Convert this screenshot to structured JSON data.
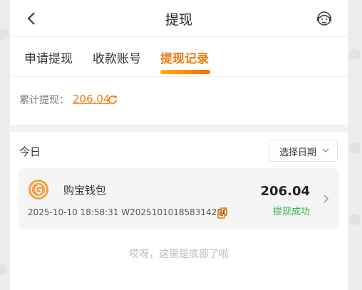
{
  "header": {
    "title": "提现",
    "back_icon": "chevron-left-icon",
    "service_icon": "customer-service-icon"
  },
  "tabs": [
    {
      "label": "申请提现",
      "active": false
    },
    {
      "label": "收款账号",
      "active": false
    },
    {
      "label": "提现记录",
      "active": true
    }
  ],
  "total": {
    "label": "累计提现：",
    "amount": "206.04",
    "refresh_icon": "refresh-icon"
  },
  "filter": {
    "period": "今日",
    "date_select": "选择日期"
  },
  "records": [
    {
      "wallet": "购宝钱包",
      "datetime": "2025-10-10 18:58:31",
      "order_no": "W202510101858314290",
      "amount": "206.04",
      "status": "提现成功"
    }
  ],
  "footer_tip": "哎呀，这里是底部了啦",
  "colors": {
    "accent": "#f17b13",
    "success": "#2db34a",
    "text": "#333333",
    "muted": "#bbbbbb"
  }
}
